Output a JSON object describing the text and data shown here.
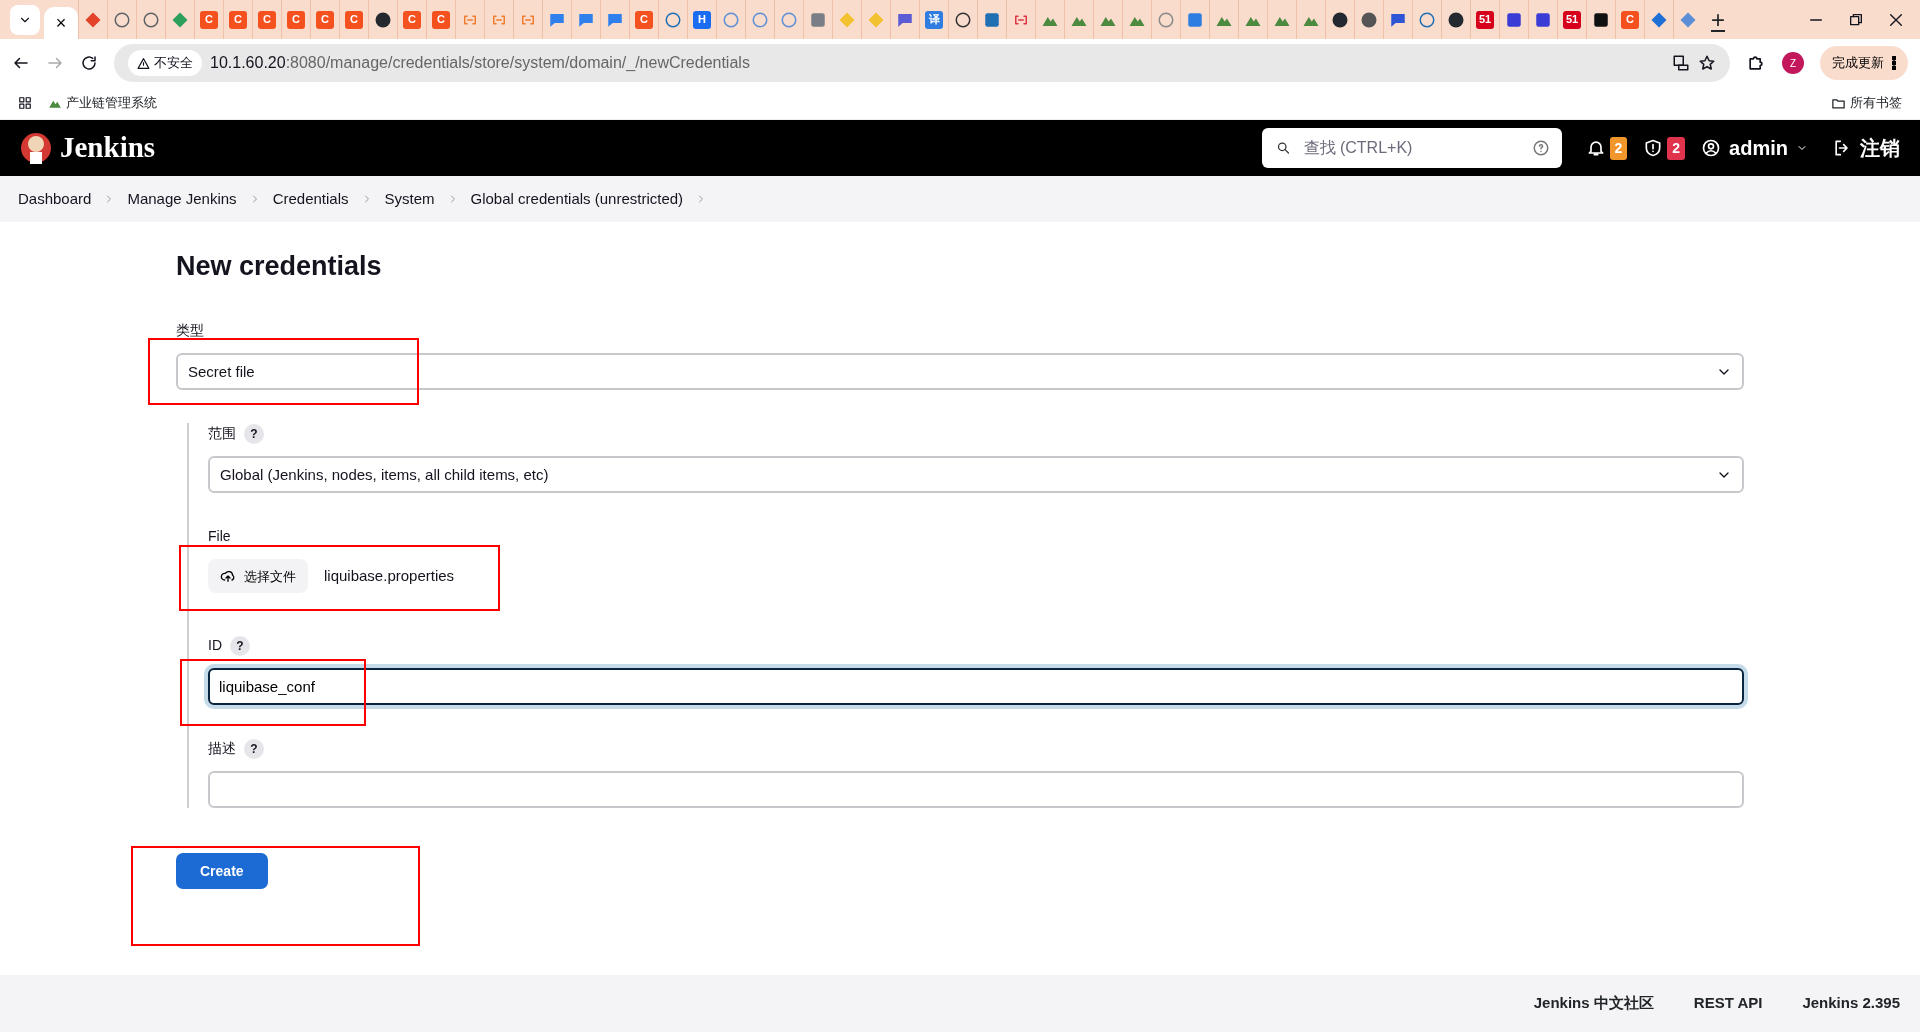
{
  "browser": {
    "tabs": [
      {
        "kind": "blank",
        "selected": true,
        "close": "×"
      },
      {
        "kind": "diamond",
        "color": "#e24329",
        "selected": false
      },
      {
        "kind": "ring",
        "color": "#5f6368",
        "selected": false
      },
      {
        "kind": "ring",
        "color": "#5f6368",
        "selected": false
      },
      {
        "kind": "diamond",
        "color": "#2e9e5b",
        "selected": false
      },
      {
        "kind": "letter",
        "glyph": "C",
        "color": "#f4511e",
        "selected": false
      },
      {
        "kind": "letter",
        "glyph": "C",
        "color": "#f4511e",
        "selected": false
      },
      {
        "kind": "letter",
        "glyph": "C",
        "color": "#f4511e",
        "selected": false
      },
      {
        "kind": "letter",
        "glyph": "C",
        "color": "#f4511e",
        "selected": false
      },
      {
        "kind": "letter",
        "glyph": "C",
        "color": "#f4511e",
        "selected": false
      },
      {
        "kind": "letter",
        "glyph": "C",
        "color": "#f4511e",
        "selected": false
      },
      {
        "kind": "circle",
        "color": "#24292f",
        "selected": false
      },
      {
        "kind": "letter",
        "glyph": "C",
        "color": "#f4511e",
        "selected": false
      },
      {
        "kind": "letter",
        "glyph": "C",
        "color": "#f4511e",
        "selected": false
      },
      {
        "kind": "link",
        "color": "#f07c2e",
        "selected": false
      },
      {
        "kind": "link",
        "color": "#f07c2e",
        "selected": false
      },
      {
        "kind": "link",
        "color": "#f07c2e",
        "selected": false
      },
      {
        "kind": "bubble",
        "color": "#2f80ed",
        "selected": false
      },
      {
        "kind": "bubble",
        "color": "#2f80ed",
        "selected": false
      },
      {
        "kind": "bubble",
        "color": "#2f80ed",
        "selected": false
      },
      {
        "kind": "letter",
        "glyph": "C",
        "color": "#f4511e",
        "selected": false
      },
      {
        "kind": "ring",
        "color": "#1f6fb5",
        "selected": false
      },
      {
        "kind": "letter",
        "glyph": "H",
        "color": "#1a6cf0",
        "selected": false
      },
      {
        "kind": "ring",
        "color": "#5b8fd6",
        "selected": false
      },
      {
        "kind": "ring",
        "color": "#5b8fd6",
        "selected": false
      },
      {
        "kind": "ring",
        "color": "#5b8fd6",
        "selected": false
      },
      {
        "kind": "square",
        "color": "#7a7f87",
        "selected": false
      },
      {
        "kind": "diamond",
        "color": "#f2c230",
        "selected": false
      },
      {
        "kind": "diamond",
        "color": "#f2c230",
        "selected": false
      },
      {
        "kind": "bubble",
        "color": "#5b5bd6",
        "selected": false
      },
      {
        "kind": "letter",
        "glyph": "译",
        "color": "#2f7de1",
        "selected": false
      },
      {
        "kind": "ring",
        "color": "#333333",
        "selected": false
      },
      {
        "kind": "square",
        "color": "#1f6fb5",
        "selected": false
      },
      {
        "kind": "link",
        "color": "#dd3344",
        "selected": false
      },
      {
        "kind": "mountain",
        "color": "#4c8a3f",
        "selected": false
      },
      {
        "kind": "mountain",
        "color": "#4c8a3f",
        "selected": false
      },
      {
        "kind": "mountain",
        "color": "#4c8a3f",
        "selected": false
      },
      {
        "kind": "mountain",
        "color": "#4c8a3f",
        "selected": false
      },
      {
        "kind": "ring",
        "color": "#888888",
        "selected": false
      },
      {
        "kind": "square",
        "color": "#2f7de1",
        "selected": false
      },
      {
        "kind": "mountain",
        "color": "#4c8a3f",
        "selected": false
      },
      {
        "kind": "mountain",
        "color": "#4c8a3f",
        "selected": false
      },
      {
        "kind": "mountain",
        "color": "#4c8a3f",
        "selected": false
      },
      {
        "kind": "mountain",
        "color": "#4c8a3f",
        "selected": false
      },
      {
        "kind": "circle",
        "color": "#24292f",
        "selected": false
      },
      {
        "kind": "circle",
        "color": "#555555",
        "selected": false
      },
      {
        "kind": "bubble",
        "color": "#2f55d4",
        "selected": false
      },
      {
        "kind": "ring",
        "color": "#1f6fb5",
        "selected": false
      },
      {
        "kind": "circle",
        "color": "#24292f",
        "selected": false
      },
      {
        "kind": "letter",
        "glyph": "51",
        "color": "#d6001c",
        "selected": false
      },
      {
        "kind": "square",
        "color": "#3b3bd6",
        "selected": false
      },
      {
        "kind": "square",
        "color": "#3b3bd6",
        "selected": false
      },
      {
        "kind": "letter",
        "glyph": "51",
        "color": "#d6001c",
        "selected": false
      },
      {
        "kind": "square",
        "color": "#111111",
        "selected": false
      },
      {
        "kind": "letter",
        "glyph": "C",
        "color": "#f4511e",
        "selected": false
      },
      {
        "kind": "diamond",
        "color": "#1f6fd4",
        "selected": false
      },
      {
        "kind": "diamond",
        "color": "#5b8fd6",
        "selected": false
      }
    ],
    "new_tab": "+",
    "url_warning": "不安全",
    "url_host": "10.1.60.20",
    "url_rest": ":8080/manage/credentials/store/system/domain/_/newCredentials",
    "profile_initial": "Z",
    "update_button": "完成更新",
    "bookmarks": [
      {
        "label": "产业链管理系统"
      }
    ],
    "all_bookmarks": "所有书签"
  },
  "header": {
    "brand": "Jenkins",
    "search_placeholder": "查找 (CTRL+K)",
    "notifications": "2",
    "security": "2",
    "user": "admin",
    "logout": "注销"
  },
  "breadcrumbs": [
    "Dashboard",
    "Manage Jenkins",
    "Credentials",
    "System",
    "Global credentials (unrestricted)"
  ],
  "title": "New credentials",
  "form": {
    "type": {
      "label": "类型",
      "value": "Secret file",
      "annotated": true
    },
    "scope": {
      "label": "范围",
      "help": "?",
      "value": "Global (Jenkins, nodes, items, all child items, etc)"
    },
    "file": {
      "label": "File",
      "button": "选择文件",
      "filename": "liquibase.properties",
      "annotated": true
    },
    "id": {
      "label": "ID",
      "help": "?",
      "value": "liquibase_conf",
      "focused": true,
      "annotated": true
    },
    "description": {
      "label": "描述",
      "help": "?",
      "focused": false
    }
  },
  "create_button": {
    "label": "Create",
    "annotated": true
  },
  "footer": [
    "Jenkins 中文社区",
    "REST API",
    "Jenkins 2.395"
  ]
}
